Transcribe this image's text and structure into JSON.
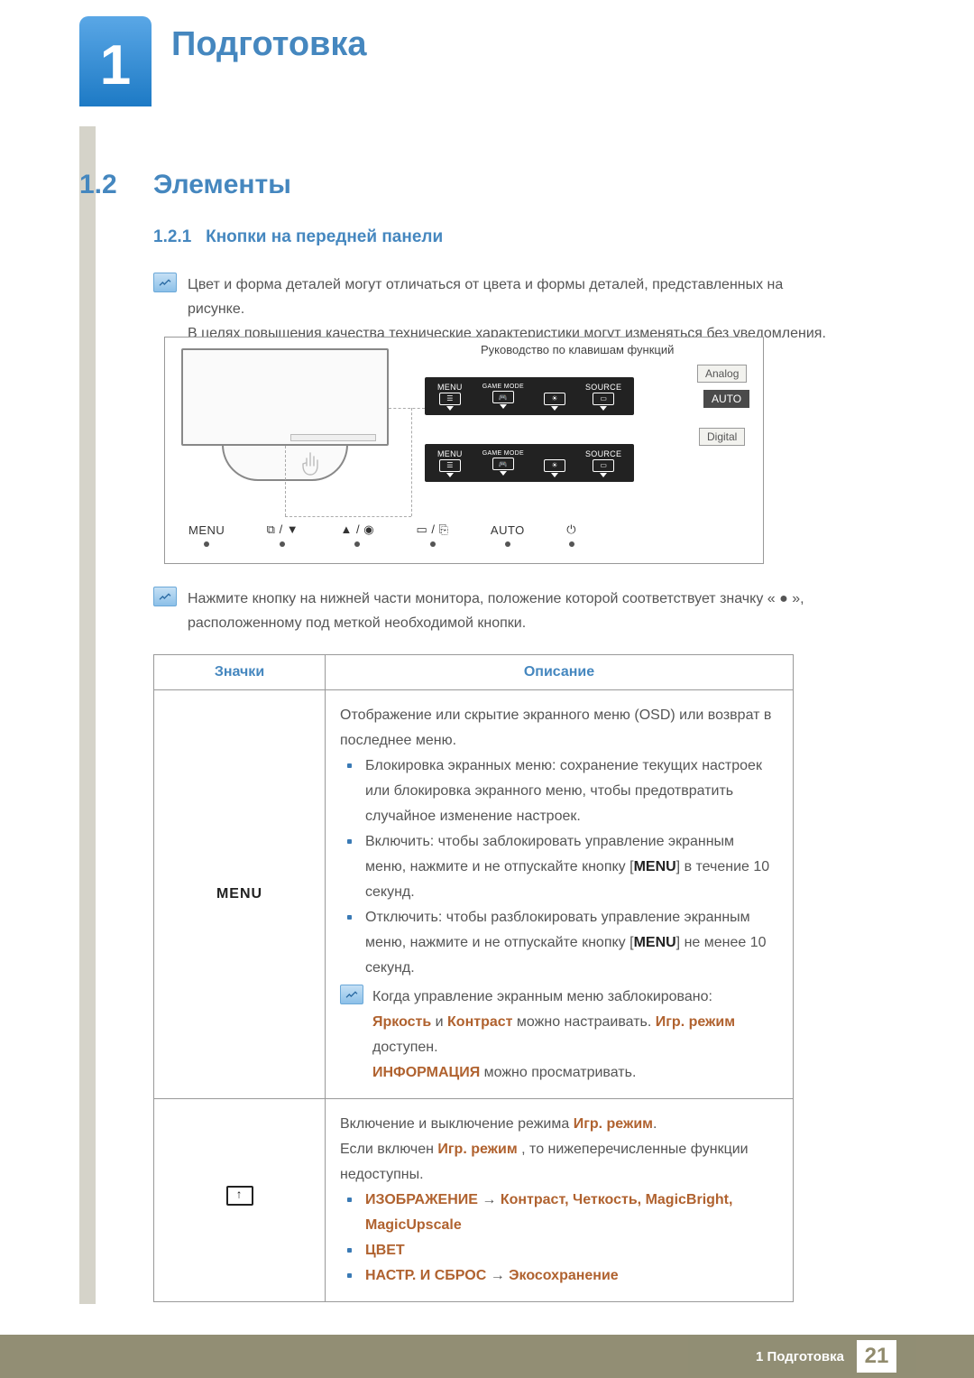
{
  "chapter": {
    "number": "1",
    "title": "Подготовка"
  },
  "section": {
    "number": "1.2",
    "title": "Элементы"
  },
  "subsection": {
    "number": "1.2.1",
    "title": "Кнопки на передней панели"
  },
  "notes": {
    "top_line1": "Цвет и форма деталей могут отличаться от цвета и формы деталей, представленных на рисунке.",
    "top_line2": "В целях повышения качества технические характеристики могут изменяться без уведомления.",
    "bottom": "Нажмите кнопку на нижней части монитора, положение которой соответствует значку « ● », расположенному под меткой необходимой кнопки."
  },
  "diagram": {
    "guide_label": "Руководство по клавишам функций",
    "tags": {
      "analog": "Analog",
      "auto": "AUTO",
      "digital": "Digital"
    },
    "osd": {
      "menu": "MENU",
      "game": "GAME MODE",
      "source": "SOURCE"
    },
    "buttons": {
      "menu": "MENU",
      "vol": "⧉ / ▼",
      "up": "▲ / ◉",
      "src": "▭ / ⎘",
      "auto": "AUTO",
      "power": "⏻"
    }
  },
  "table": {
    "headers": {
      "icons": "Значки",
      "desc": "Описание"
    },
    "row1": {
      "icon_label": "MENU",
      "p1": "Отображение или скрытие экранного меню (OSD) или возврат в последнее меню.",
      "b1": "Блокировка экранных меню: сохранение текущих настроек или блокировка экранного меню, чтобы предотвратить случайное изменение настроек.",
      "b2a": "Включить: чтобы заблокировать управление экранным меню, нажмите и не отпускайте кнопку [",
      "b2b": "] в течение 10 секунд.",
      "b3a": "Отключить: чтобы разблокировать управление экранным меню, нажмите и не отпускайте кнопку [",
      "b3b": "] не менее 10 секунд.",
      "note_intro": "Когда управление экранным меню заблокировано:",
      "note_line1_a": "Яркость",
      "note_line1_b": " и ",
      "note_line1_c": "Контраст",
      "note_line1_d": " можно настраивать. ",
      "note_line1_e": "Игр. режим",
      "note_line1_f": " доступен.",
      "note_line2_a": "ИНФОРМАЦИЯ",
      "note_line2_b": " можно просматривать."
    },
    "row2": {
      "p1a": "Включение и выключение режима ",
      "p1b": "Игр. режим",
      "p1c": ".",
      "p2a": "Если включен ",
      "p2b": "Игр. режим",
      "p2c": " , то нижеперечисленные функции недоступны.",
      "b1a": "ИЗОБРАЖЕНИЕ",
      "b1b": " → ",
      "b1c": "Контраст",
      "b1d": ", ",
      "b1e": "Четкость",
      "b1f": ", ",
      "b1g": "MagicBright",
      "b1h": ", ",
      "b1i": "MagicUpscale",
      "b2": "ЦВЕТ",
      "b3a": "НАСТР. И СБРОС",
      "b3b": " → ",
      "b3c": "Экосохранение"
    }
  },
  "footer": {
    "text": "1 Подготовка",
    "page": "21"
  }
}
